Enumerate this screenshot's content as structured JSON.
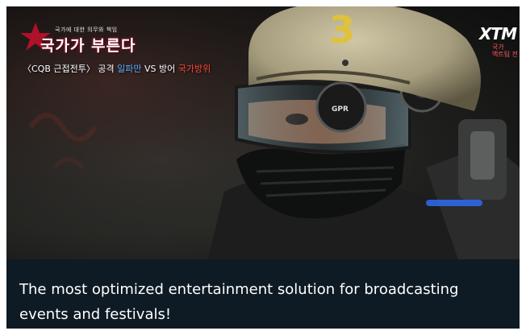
{
  "image": {
    "description_icon": "broadcast-still-helmet-figure",
    "overlay": {
      "tagline": "국가에 대한 의무와 책임",
      "title": "국가가 부른다",
      "subtitle_prefix": "〈CQB 근접전투〉 공격 ",
      "subtitle_attack": "일파만",
      "subtitle_vs": " VS 방어 ",
      "subtitle_defense": "국가방위"
    },
    "channel": {
      "logo_text": "XTM",
      "sub_line1": "국가",
      "sub_line2": "액트팀 전"
    },
    "helmet_number": "3",
    "goggle_label": "GPR"
  },
  "caption": {
    "text": "The most optimized entertainment solution for broadcasting events and festivals!"
  },
  "colors": {
    "caption_bg": "#0e1b25",
    "highlight_blue": "#5fb3ff",
    "highlight_red": "#ff4a3a"
  }
}
